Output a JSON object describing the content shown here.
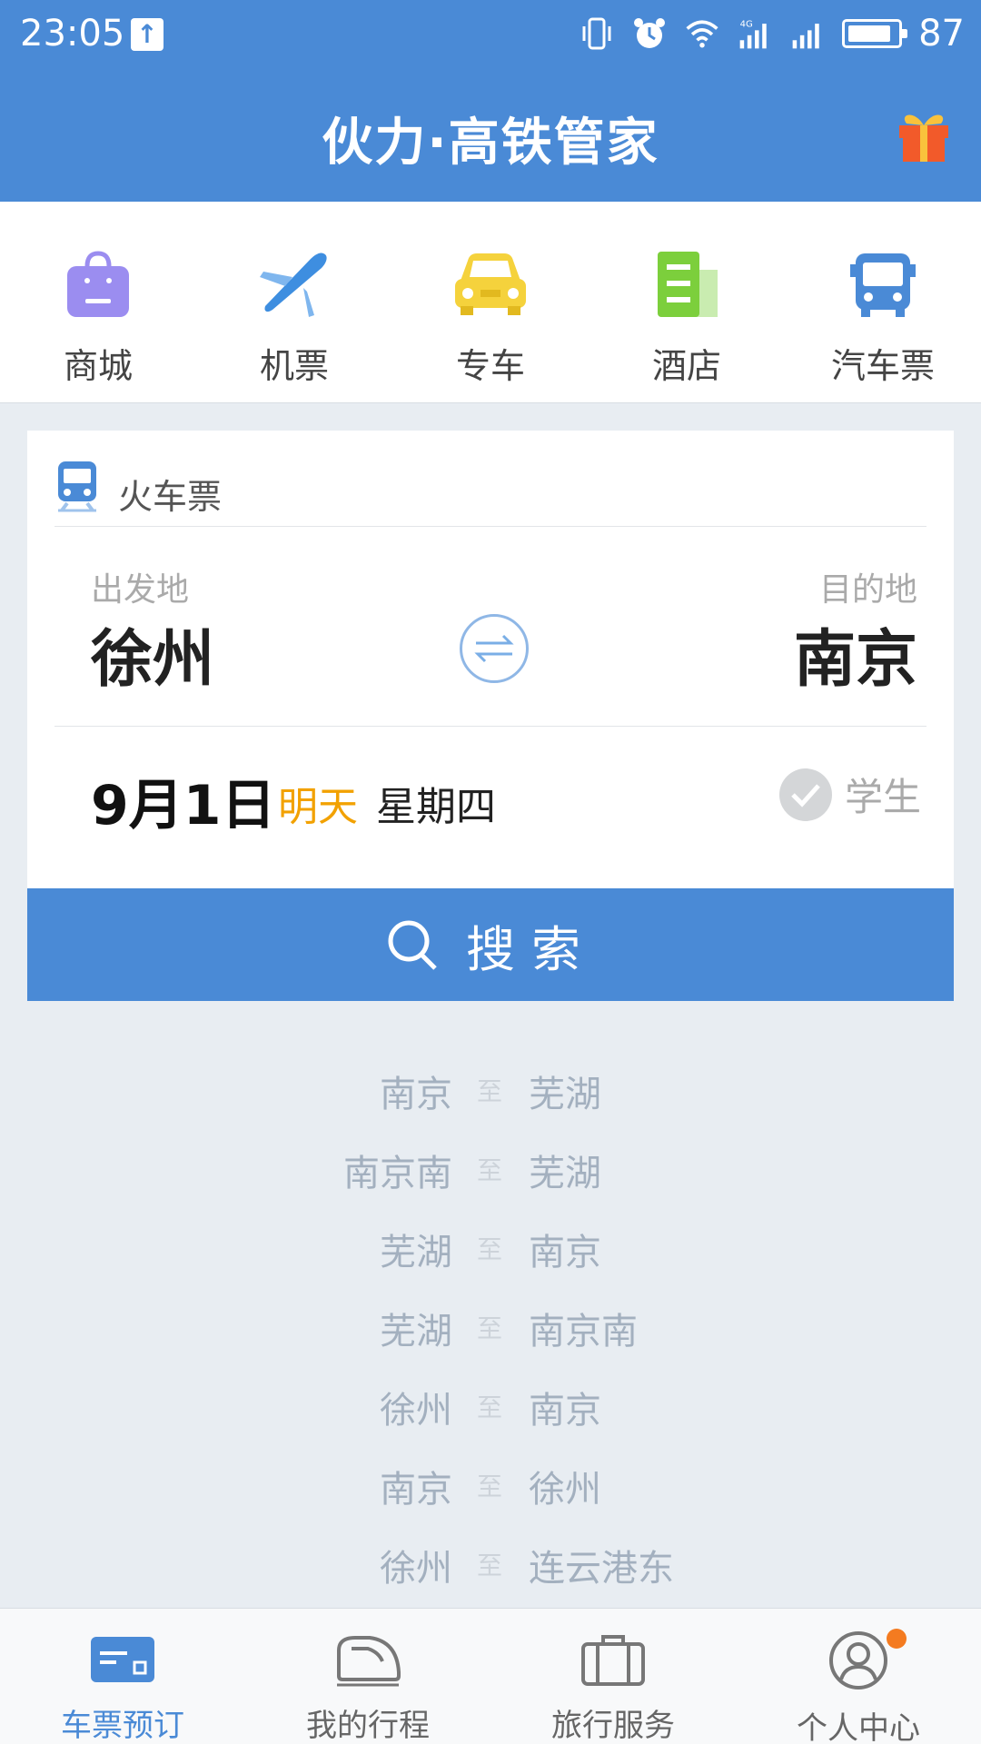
{
  "status_bar": {
    "time": "23:05",
    "battery_pct": "87",
    "icons": [
      "upload-icon",
      "vibrate-icon",
      "alarm-icon",
      "wifi-icon",
      "4g-signal-icon",
      "signal-icon",
      "battery-icon"
    ]
  },
  "header": {
    "title": "伙力·高铁管家",
    "gift_icon": "gift-icon"
  },
  "services": [
    {
      "label": "商城",
      "icon": "shopping-bag-icon",
      "color": "#9b8df0"
    },
    {
      "label": "机票",
      "icon": "airplane-icon",
      "color": "#3e8ee0"
    },
    {
      "label": "专车",
      "icon": "car-icon",
      "color": "#f5d23c"
    },
    {
      "label": "酒店",
      "icon": "hotel-icon",
      "color": "#7ccf3c"
    },
    {
      "label": "汽车票",
      "icon": "bus-icon",
      "color": "#4a8ad6"
    }
  ],
  "ticket": {
    "title": "火车票",
    "from_label": "出发地",
    "from_city": "徐州",
    "to_label": "目的地",
    "to_city": "南京",
    "date": "9月1日",
    "date_relative": "明天",
    "weekday": "星期四",
    "student_label": "学生",
    "search_label": "搜索"
  },
  "history": [
    {
      "from": "南京",
      "sep": "至",
      "to": "芜湖"
    },
    {
      "from": "南京南",
      "sep": "至",
      "to": "芜湖"
    },
    {
      "from": "芜湖",
      "sep": "至",
      "to": "南京"
    },
    {
      "from": "芜湖",
      "sep": "至",
      "to": "南京南"
    },
    {
      "from": "徐州",
      "sep": "至",
      "to": "南京"
    },
    {
      "from": "南京",
      "sep": "至",
      "to": "徐州"
    },
    {
      "from": "徐州",
      "sep": "至",
      "to": "连云港东"
    }
  ],
  "bottom_nav": [
    {
      "label": "车票预订",
      "icon": "ticket-card-icon",
      "active": true
    },
    {
      "label": "我的行程",
      "icon": "train-icon",
      "active": false
    },
    {
      "label": "旅行服务",
      "icon": "briefcase-icon",
      "active": false
    },
    {
      "label": "个人中心",
      "icon": "user-icon",
      "active": false
    }
  ],
  "colors": {
    "primary": "#4a8ad6",
    "accent_orange": "#f2a100",
    "notification_dot": "#f47b20"
  }
}
